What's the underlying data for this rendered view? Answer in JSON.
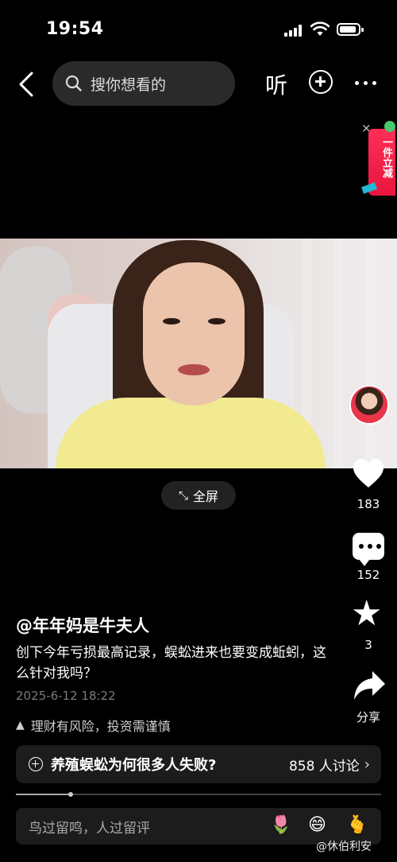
{
  "status_bar": {
    "time": "19:54"
  },
  "top_bar": {
    "search_placeholder": "搜你想看的",
    "listen_label": "听"
  },
  "promo": {
    "text": "一件立减",
    "close": "×"
  },
  "video": {
    "fullscreen_label": "全屏"
  },
  "side_actions": {
    "likes": "183",
    "comments": "152",
    "favorites": "3",
    "share_label": "分享"
  },
  "post": {
    "author": "@年年妈是牛夫人",
    "description": "创下今年亏损最高记录，蜈蚣进来也要变成蚯蚓，这么针对我吗？",
    "date": "2025-6-12 18:22",
    "risk_notice": "理财有风险，投资需谨慎"
  },
  "topic": {
    "title": "养殖蜈蚣为何很多人失败?",
    "count": "858 人讨论"
  },
  "playback": {
    "progress": 0.15
  },
  "comment_input": {
    "placeholder": "鸟过留鸣，人过留评"
  },
  "watermark": "@休伯利安",
  "colors": {
    "background": "#000000",
    "promo": "#ff2e55",
    "accent": "#ffffff"
  },
  "icons": [
    "back-icon",
    "search-icon",
    "plus-icon",
    "more-icon",
    "heart-icon",
    "comment-icon",
    "star-icon",
    "share-icon",
    "warning-icon",
    "fullscreen-icon"
  ]
}
